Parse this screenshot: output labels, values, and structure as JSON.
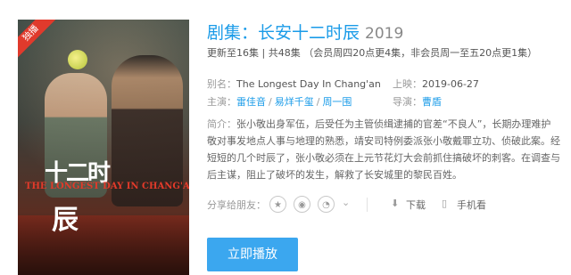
{
  "poster": {
    "badge": "独播",
    "logo_cn_line1": "十二时",
    "logo_cn_line2": "辰",
    "logo_en": "THE LONGEST DAY IN CHANG'AN"
  },
  "show": {
    "title": "剧集：长安十二时辰",
    "year": "2019",
    "update_info": "更新至16集 | 共48集 （会员周四20点更4集，非会员周一至五20点更1集）"
  },
  "meta": {
    "alias_label": "别名：",
    "alias_value": "The Longest Day In Chang'an",
    "release_label": "上映：",
    "release_value": "2019-06-27",
    "cast_label": "主演：",
    "cast": [
      "雷佳音",
      "易烊千玺",
      "周一围"
    ],
    "cast_sep": "/",
    "director_label": "导演：",
    "director": "曹盾"
  },
  "synopsis": {
    "label": "简介：",
    "lines": [
      "张小敬出身军伍，后受任为主管侦缉逮捕的官差“不良人”，长期办理难护",
      "敬对事发地点人事与地理的熟悉，靖安司特例委派张小敬戴罪立功、侦破此案。经",
      "短短的几个时辰了，张小敬必须在上元节花灯大会前抓住搞破坏的刺客。在调查与",
      "后主谋，阻止了破坏的发生，解救了长安城里的黎民百姓。"
    ]
  },
  "share": {
    "label": "分享给朋友：",
    "download_label": "下载",
    "mobile_label": "手机看"
  },
  "actions": {
    "play_label": "立即播放"
  },
  "colors": {
    "accent": "#1a9be8",
    "button": "#3ba7ef",
    "badge": "#e03a2c"
  }
}
